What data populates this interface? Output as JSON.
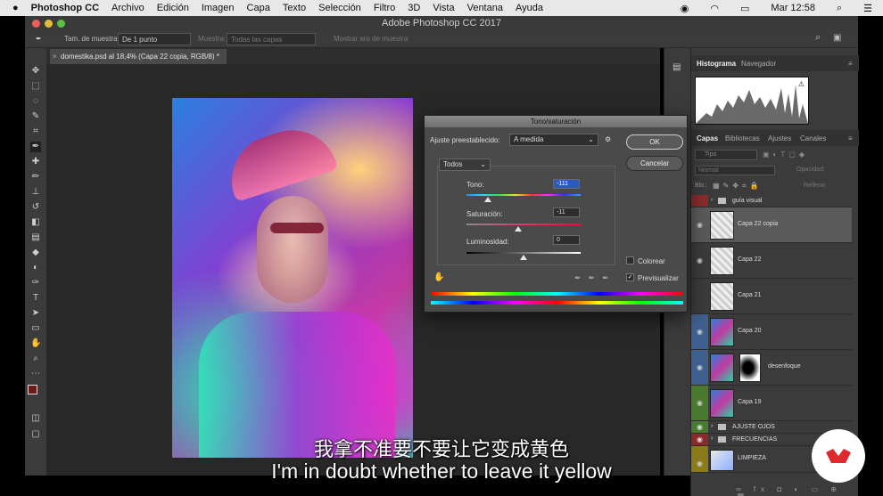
{
  "menubar": {
    "app_name": "Photoshop CC",
    "items": [
      "Archivo",
      "Edición",
      "Imagen",
      "Capa",
      "Texto",
      "Selección",
      "Filtro",
      "3D",
      "Vista",
      "Ventana",
      "Ayuda"
    ],
    "clock": "Mar 12:58"
  },
  "window": {
    "title": "Adobe Photoshop CC 2017"
  },
  "options": {
    "sample_size_label": "Tam. de muestra:",
    "sample_size_value": "De 1 punto",
    "sample_label": "Muestra:",
    "sample_value": "Todas las capas",
    "show_ring_label": "Mostrar aro de muestra"
  },
  "document": {
    "tab_label": "domestika.psd al 18,4% (Capa 22 copia, RGB/8) *"
  },
  "dialog": {
    "title": "Tono/saturación",
    "preset_label": "Ajuste preestablecido:",
    "preset_value": "A medida",
    "channel_value": "Todos",
    "ok_label": "OK",
    "cancel_label": "Cancelar",
    "hue_label": "Tono:",
    "hue_value": "-111",
    "hue_level": 0.19,
    "saturation_label": "Saturación:",
    "saturation_value": "-11",
    "saturation_level": 0.45,
    "lightness_label": "Luminosidad:",
    "lightness_value": "0",
    "lightness_level": 0.5,
    "colorize_label": "Colorear",
    "colorize_checked": false,
    "preview_label": "Previsualizar",
    "preview_checked": true
  },
  "panels": {
    "top_tabs": [
      "Histograma",
      "Navegador"
    ],
    "layer_tabs": [
      "Capas",
      "Bibliotecas",
      "Ajustes",
      "Canales"
    ],
    "search_placeholder": "Tipo",
    "blend_mode": "Normal",
    "opacity_label": "Opacidad:",
    "fill_label": "Relleno:",
    "lock_label": "Blo.:",
    "layers": [
      {
        "name": "guía visual",
        "kind": "group",
        "color": "#8a2b2b"
      },
      {
        "name": "Capa 22 copia",
        "kind": "layer",
        "color": "",
        "selected": true
      },
      {
        "name": "Capa 22",
        "kind": "layer",
        "color": ""
      },
      {
        "name": "Capa 21",
        "kind": "layer",
        "color": ""
      },
      {
        "name": "Capa 20",
        "kind": "layer",
        "color": "#3f5f8f"
      },
      {
        "name": "desenfoque",
        "kind": "layer",
        "color": "#3f5f8f"
      },
      {
        "name": "Capa 19",
        "kind": "layer",
        "color": "#4a7a2f"
      },
      {
        "name": "AJUSTE OJOS",
        "kind": "group",
        "color": "#4a7a2f"
      },
      {
        "name": "FRECUENCIAS",
        "kind": "group",
        "color": "#8a2b2b"
      },
      {
        "name": "LIMPIEZA",
        "kind": "layer",
        "color": "#8a7a1a"
      }
    ]
  },
  "subtitles": {
    "zh": "我拿不准要不要让它变成黄色",
    "en": "I'm in doubt whether to leave it yellow"
  }
}
